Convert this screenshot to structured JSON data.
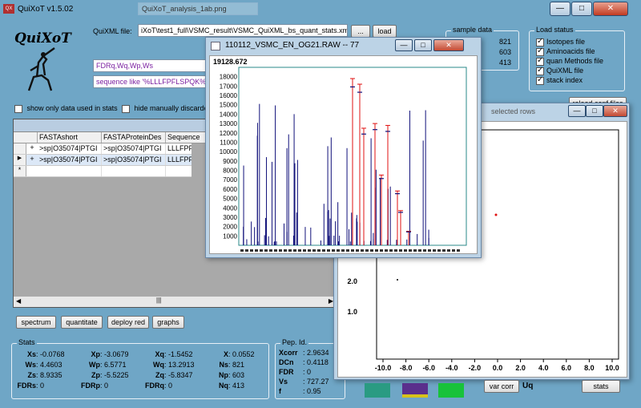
{
  "app": {
    "title": "QuiXoT v1.5.02",
    "logo_text": "QuiXoT",
    "bg_tab_title": "QuiXoT_analysis_1ab.png"
  },
  "file": {
    "label": "QuiXML file:",
    "value": "iXoT\\test1_full\\VSMC_result\\VSMC_QuiXML_bs_quant_stats.xml",
    "browse": "...",
    "load": "load"
  },
  "filters": {
    "fields": "FDRq,Wq,Wp,Ws",
    "sequence": "sequence like '%LLLFPFLSPQK%'"
  },
  "checks": {
    "only_used": "show only data used in stats",
    "hide_discarded": "hide manually discarded"
  },
  "grid": {
    "columns": [
      "FASTAshort",
      "FASTAProteinDes",
      "Sequence"
    ],
    "rows": [
      {
        "marker": "",
        "expand": "+",
        "c1": ">sp|O35074|PTGI",
        "c2": ">sp|O35074|PTGI",
        "c3": "LLLFPFLS"
      },
      {
        "marker": "▶",
        "expand": "+",
        "c1": ">sp|O35074|PTGI",
        "c2": ">sp|O35074|PTGI",
        "c3": "LLLFPFLS"
      },
      {
        "marker": "*",
        "expand": "",
        "c1": "",
        "c2": "",
        "c3": ""
      }
    ]
  },
  "actions": {
    "spectrum": "spectrum",
    "quantitate": "quantitate",
    "deploy": "deploy red",
    "graphs": "graphs"
  },
  "stats": {
    "title": "Stats",
    "rows": [
      [
        {
          "k": "Xs",
          "v": ": -0.0768"
        },
        {
          "k": "Xp",
          "v": ": -3.0679"
        },
        {
          "k": "Xq",
          "v": ": -1.5452"
        },
        {
          "k": "X",
          "v": ": 0.0552"
        }
      ],
      [
        {
          "k": "Ws",
          "v": ": 4.4603"
        },
        {
          "k": "Wp",
          "v": ": 6.5771"
        },
        {
          "k": "Wq",
          "v": ": 13.2913"
        },
        {
          "k": "Ns",
          "v": ": 821"
        }
      ],
      [
        {
          "k": "Zs",
          "v": ": 8.9335"
        },
        {
          "k": "Zp",
          "v": ": -5.5225"
        },
        {
          "k": "Zq",
          "v": ": -5.8347"
        },
        {
          "k": "Np",
          "v": ": 603"
        }
      ],
      [
        {
          "k": "FDRs",
          "v": ": 0"
        },
        {
          "k": "FDRp",
          "v": ": 0"
        },
        {
          "k": "FDRq",
          "v": ": 0"
        },
        {
          "k": "Nq",
          "v": ": 413"
        }
      ]
    ]
  },
  "pep": {
    "title": "Pep. Id.",
    "rows": [
      {
        "k": "Xcorr",
        "v": ": 2.9634"
      },
      {
        "k": "DCn",
        "v": ": 0.4118"
      },
      {
        "k": "FDR",
        "v": ": 0"
      },
      {
        "k": "Vs",
        "v": ": 727.27"
      },
      {
        "k": "f",
        "v": ": 0.95"
      }
    ]
  },
  "sample": {
    "title": "sample data",
    "values": [
      "821",
      "603",
      "413"
    ]
  },
  "load_status": {
    "title": "Load status",
    "items": [
      "Isotopes file",
      "Aminoacids file",
      "quan Methods file",
      "QuiXML file",
      "stack index"
    ],
    "reload": "reload conf files"
  },
  "spectrum_win": {
    "title": "110112_VSMC_EN_OG21.RAW -- 77",
    "max_label": "19128.672",
    "y_ticks": [
      "18000",
      "17000",
      "16000",
      "15000",
      "14000",
      "13000",
      "12000",
      "11000",
      "10000",
      "9000",
      "8000",
      "7000",
      "6000",
      "5000",
      "4000",
      "3000",
      "2000",
      "1000"
    ]
  },
  "graph_win": {
    "x_ticks": [
      "-10.0",
      "-8.0",
      "-6.0",
      "-4.0",
      "-2.0",
      "0.0",
      "2.0",
      "4.0",
      "6.0",
      "8.0",
      "10.0"
    ],
    "y_ticks": [
      "2.0",
      "1.0"
    ],
    "var_corr": "var corr",
    "stats_btn": "stats",
    "partial_label": "selected rows",
    "partial_label2": "Uq"
  },
  "colors": {
    "accent": "#6fa6c6",
    "red_peak": "#e01010",
    "blue_peak": "#10107a",
    "swatch1": "#2a9b82",
    "swatch2": "#5a2f8c",
    "swatch3": "#18c23a"
  }
}
